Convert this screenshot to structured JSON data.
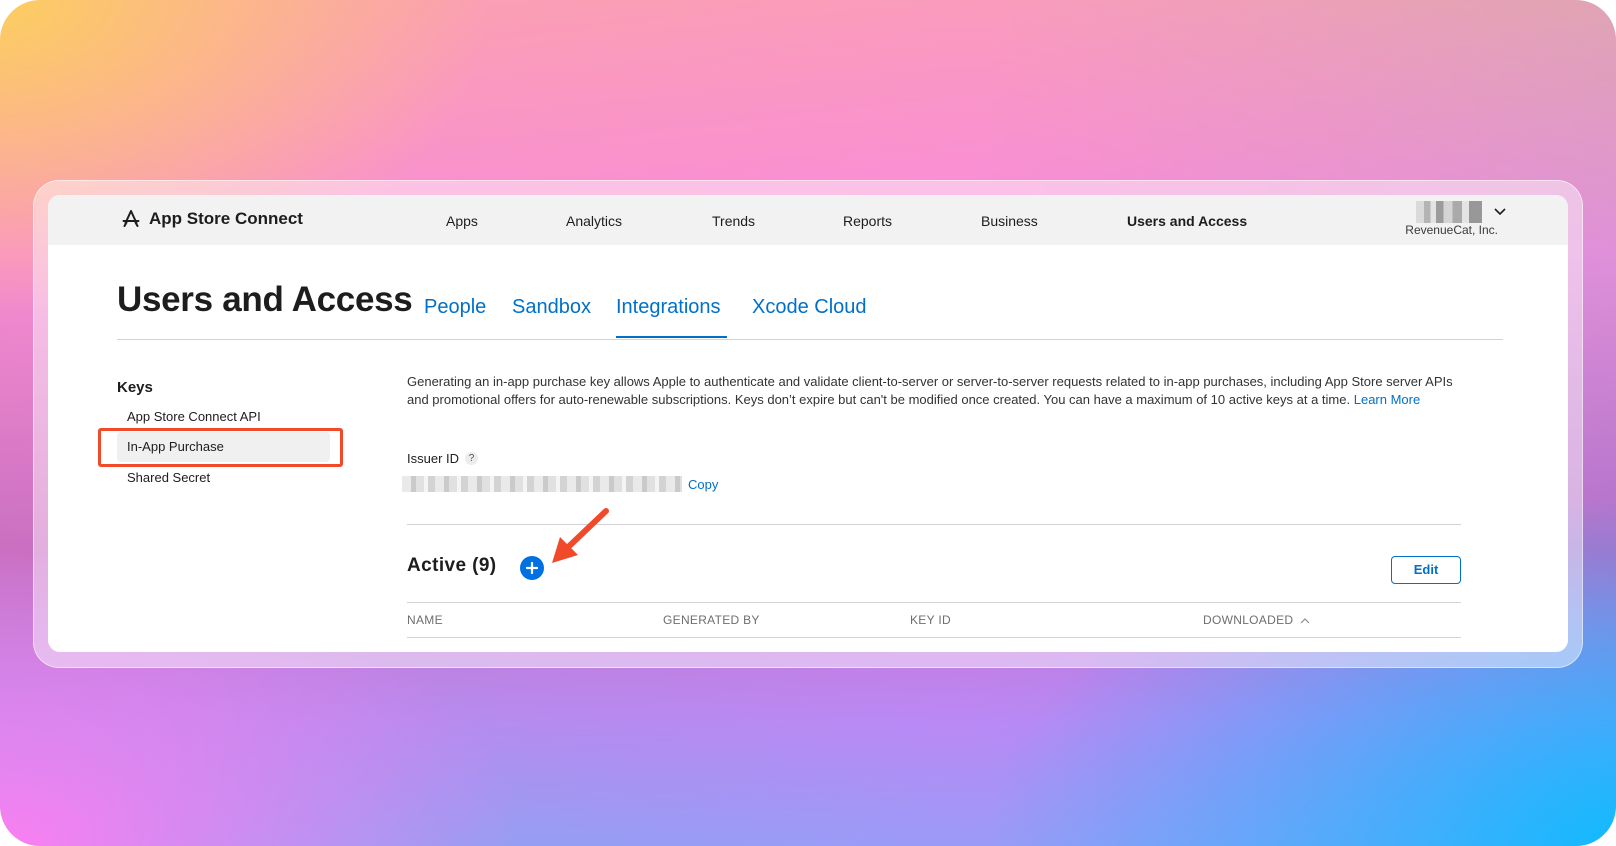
{
  "app": {
    "name": "App Store Connect",
    "logo_icon": "app-store-icon"
  },
  "topnav": {
    "items": [
      {
        "label": "Apps"
      },
      {
        "label": "Analytics"
      },
      {
        "label": "Trends"
      },
      {
        "label": "Reports"
      },
      {
        "label": "Business"
      },
      {
        "label": "Users and Access",
        "active": true
      }
    ],
    "account": {
      "organization": "RevenueCat, Inc.",
      "name_redacted": true,
      "chevron_icon": "chevron-down-icon",
      "chevron_glyph": "⌄"
    }
  },
  "page": {
    "title": "Users and Access",
    "tabs": [
      {
        "label": "People"
      },
      {
        "label": "Sandbox"
      },
      {
        "label": "Integrations",
        "active": true
      },
      {
        "label": "Xcode Cloud"
      }
    ]
  },
  "sidebar": {
    "heading": "Keys",
    "items": [
      {
        "label": "App Store Connect API"
      },
      {
        "label": "In-App Purchase",
        "selected": true,
        "highlighted": true
      },
      {
        "label": "Shared Secret"
      }
    ]
  },
  "content": {
    "description": "Generating an in-app purchase key allows Apple to authenticate and validate client-to-server or server-to-server requests related to in-app purchases, including App Store server APIs and promotional offers for auto-renewable subscriptions. Keys don’t expire but can't be modified once created. You can have a maximum of 10 active keys at a time.",
    "learn_more": "Learn More",
    "issuer": {
      "label": "Issuer ID",
      "help_glyph": "?",
      "value_redacted": true,
      "copy_label": "Copy"
    },
    "active": {
      "title": "Active (9)",
      "count": 9,
      "add_glyph": "+",
      "edit_label": "Edit"
    },
    "table": {
      "columns": [
        "NAME",
        "GENERATED BY",
        "KEY ID",
        "DOWNLOADED"
      ],
      "sort_column": "DOWNLOADED",
      "sort_glyph": "^"
    }
  },
  "annotations": {
    "highlight_color": "#f04a2b",
    "arrow_color": "#f04a2b"
  },
  "colors": {
    "link": "#0070c9",
    "add_button": "#0071e3"
  }
}
